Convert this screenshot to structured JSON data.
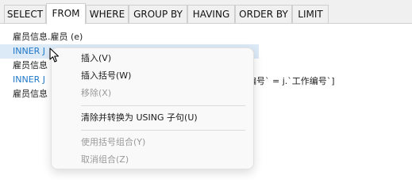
{
  "tabs": [
    {
      "label": "SELECT"
    },
    {
      "label": "FROM",
      "active": true
    },
    {
      "label": "WHERE"
    },
    {
      "label": "GROUP BY"
    },
    {
      "label": "HAVING"
    },
    {
      "label": "ORDER BY"
    },
    {
      "label": "LIMIT"
    }
  ],
  "editor": {
    "line1": "雇员信息.雇员 (e)",
    "line2": "INNER J",
    "line3": "雇员信息",
    "line4": "INNER J",
    "line4_tail": "编号` = j.`工作编号`]",
    "line5": "雇员信息"
  },
  "context_menu": {
    "insert": "插入(V)",
    "insert_brackets": "插入括号(W)",
    "remove": "移除(X)",
    "clear_convert_using": "清除并转换为 USING 子句(U)",
    "use_bracket_group": "使用括号组合(Y)",
    "ungroup": "取消组合(Z)"
  },
  "colors": {
    "keyword": "#1f78c8",
    "selection": "#dce9f7",
    "disabled": "#9a9a9a"
  }
}
